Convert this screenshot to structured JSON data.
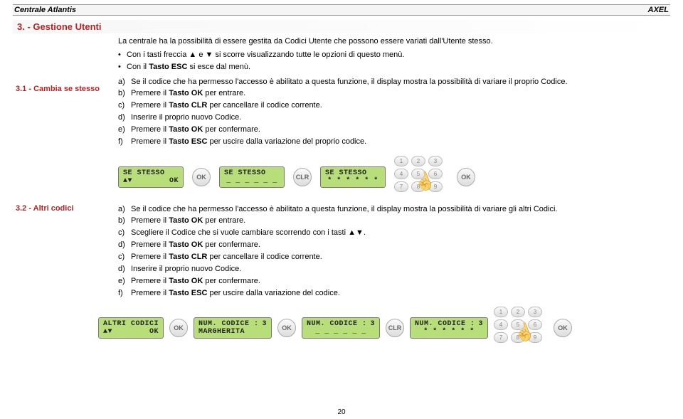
{
  "header": {
    "left": "Centrale Atlantis",
    "right": "AXEL"
  },
  "section3": {
    "title": "3. - Gestione Utenti"
  },
  "section31": {
    "label": "3.1 - Cambia se stesso",
    "intro": "La centrale ha la possibilità di essere gestita da Codici Utente che possono essere variati  dall'Utente stesso.",
    "b1": "Con i tasti freccia ▲ e ▼ si scorre visualizzando tutte le opzioni di questo menù.",
    "b2a": "Con il ",
    "b2b": "Tasto ESC",
    "b2c": " si esce dal menù.",
    "a": "Se il codice che ha permesso l'accesso è abilitato a questa funzione, il display mostra la possibilità di variare il proprio Codice.",
    "b_1": "Premere il ",
    "b_2": "Tasto OK",
    "b_3": " per entrare.",
    "c_1": "Premere il ",
    "c_2": "Tasto CLR",
    "c_3": " per cancellare il codice corrente.",
    "d": "Inserire il proprio nuovo Codice.",
    "e_1": "Premere il ",
    "e_2": "Tasto OK",
    "e_3": " per confermare.",
    "f_1": "Premere il ",
    "f_2": "Tasto ESC",
    "f_3": " per uscire dalla variazione del proprio codice."
  },
  "displays31": {
    "d1l1": "SE STESSO",
    "d1l2l": "▲▼",
    "d1l2r": "OK",
    "d2l1": "SE STESSO",
    "d2l2": "_ _ _ _ _ _",
    "d3l1": "SE STESSO",
    "d3l2": "* * * * * *",
    "ok": "OK",
    "clr": "CLR"
  },
  "section32": {
    "label": "3.2 - Altri codici",
    "a": "Se il codice che ha permesso l'accesso è abilitato a questa funzione, il display mostra la possibilità di variare gli altri Codici.",
    "b_1": "Premere il ",
    "b_2": "Tasto OK",
    "b_3": " per entrare.",
    "c": "Scegliere il Codice che si vuole cambiare scorrendo con i tasti ▲▼.",
    "d_1": "Premere il ",
    "d_2": "Tasto OK",
    "d_3": " per confermare.",
    "c2_1": "Premere il ",
    "c2_2": "Tasto CLR",
    "c2_3": " per cancellare il codice corrente.",
    "d2": "Inserire il proprio nuovo Codice.",
    "e_1": "Premere il ",
    "e_2": "Tasto OK",
    "e_3": " per confermare.",
    "f_1": "Premere il ",
    "f_2": "Tasto ESC",
    "f_3": " per uscire dalla variazione del codice."
  },
  "displays32": {
    "d1l1": "ALTRI CODICI",
    "d1l2l": "▲▼",
    "d1l2r": "OK",
    "d2l1": "NUM. CODICE :",
    "d2l1n": "3",
    "d2l2": "MARGHERITA",
    "d3l1": "NUM. CODICE :",
    "d3l1n": "3",
    "d3l2": "_ _ _ _ _ _",
    "d4l1": "NUM. CODICE :",
    "d4l1n": "3",
    "d4l2": "* * * * * *",
    "ok": "OK",
    "clr": "CLR"
  },
  "keypad": {
    "k1": "1",
    "k2": "2",
    "k3": "3",
    "k4": "4",
    "k5": "5",
    "k6": "6",
    "k7": "7",
    "k8": "8",
    "k9": "9"
  },
  "page": "20"
}
